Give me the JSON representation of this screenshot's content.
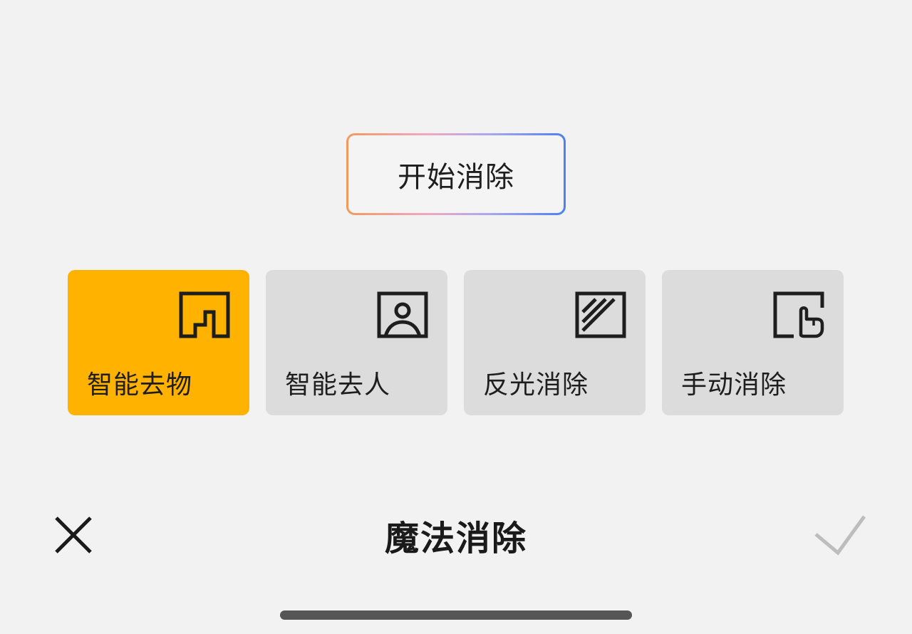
{
  "start_button": {
    "label": "开始消除"
  },
  "modes": [
    {
      "label": "智能去物",
      "icon": "object-remove-icon",
      "selected": true
    },
    {
      "label": "智能去人",
      "icon": "person-remove-icon",
      "selected": false
    },
    {
      "label": "反光消除",
      "icon": "reflection-remove-icon",
      "selected": false
    },
    {
      "label": "手动消除",
      "icon": "manual-erase-icon",
      "selected": false
    }
  ],
  "toolbar": {
    "title": "魔法消除",
    "close_icon": "close-icon",
    "confirm_icon": "check-icon"
  },
  "colors": {
    "accent": "#ffb300",
    "background": "#f2f2f2",
    "card": "#dcdcdc",
    "gradient_start": "#f09a5e",
    "gradient_end": "#4f7ff0",
    "confirm_disabled": "#bdbdbd"
  }
}
